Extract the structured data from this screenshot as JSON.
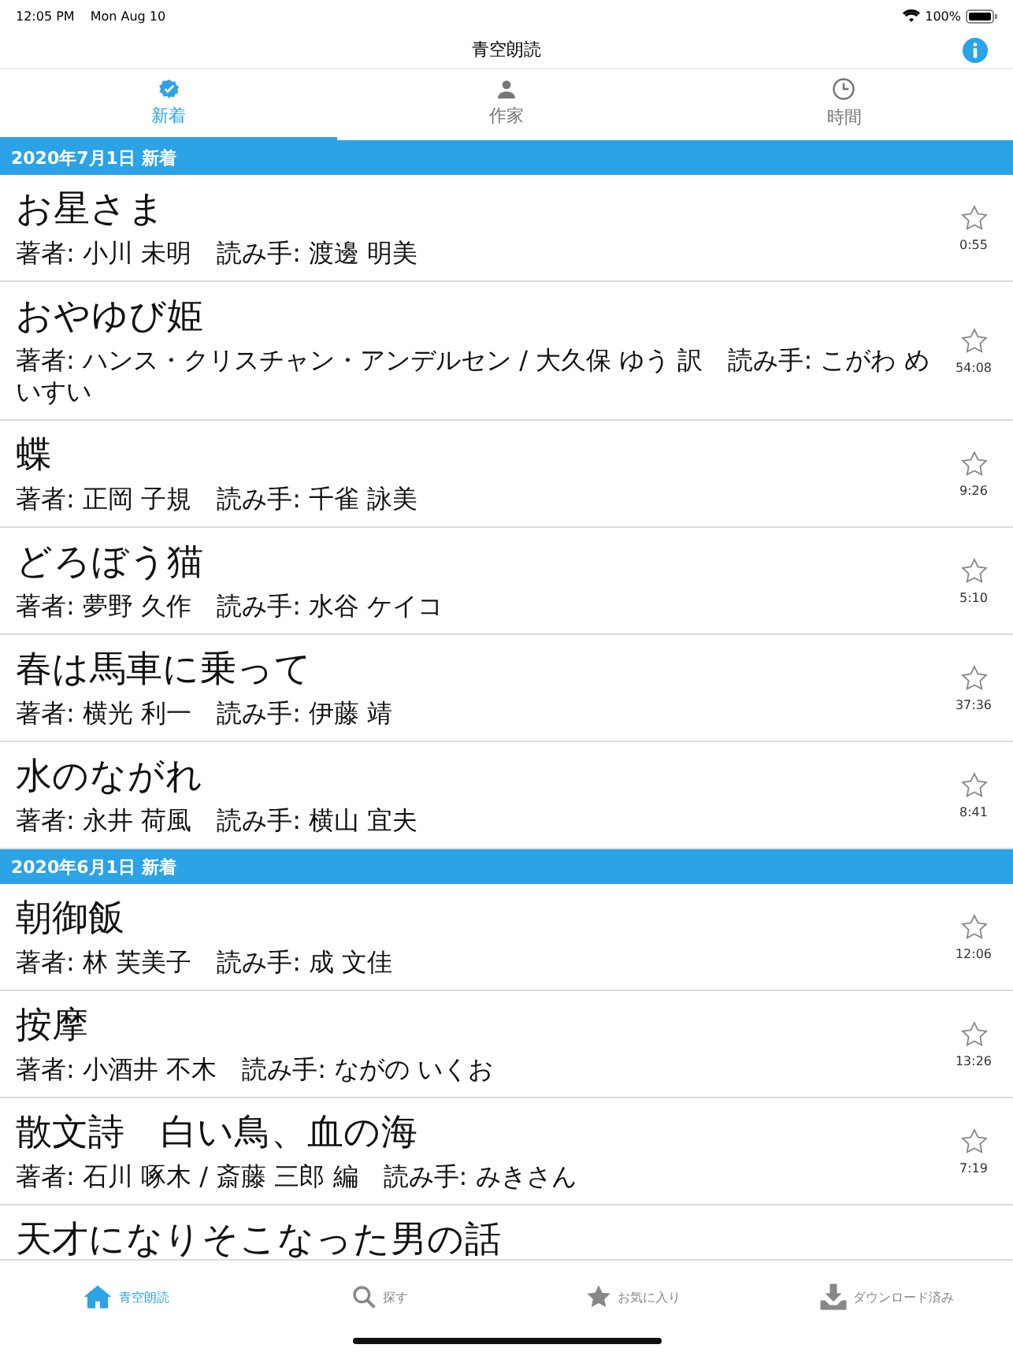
{
  "status_bar": {
    "time": "12:05 PM",
    "date": "Mon Aug 10",
    "battery": "100%"
  },
  "nav_bar": {
    "title": "青空朗読"
  },
  "tabs": [
    {
      "label": "新着",
      "kind": "badge",
      "selected": true
    },
    {
      "label": "作家",
      "kind": "person",
      "selected": false
    },
    {
      "label": "時間",
      "kind": "clock",
      "selected": false
    }
  ],
  "sections": [
    {
      "header": "2020年7月1日 新着",
      "rows": [
        {
          "title": "お星さま",
          "subtitle": "著者: 小川 未明　読み手: 渡邊 明美",
          "duration": "0:55"
        },
        {
          "title": "おやゆび姫",
          "subtitle": "著者: ハンス・クリスチャン・アンデルセン / 大久保 ゆう 訳　読み手: こがわ めいすい",
          "duration": "54:08"
        },
        {
          "title": "蝶",
          "subtitle": "著者: 正岡 子規　読み手: 千雀 詠美",
          "duration": "9:26"
        },
        {
          "title": "どろぼう猫",
          "subtitle": "著者: 夢野 久作　読み手: 水谷 ケイコ",
          "duration": "5:10"
        },
        {
          "title": "春は馬車に乗って",
          "subtitle": "著者: 横光 利一　読み手: 伊藤 靖",
          "duration": "37:36"
        },
        {
          "title": "水のながれ",
          "subtitle": "著者: 永井 荷風　読み手: 横山 宜夫",
          "duration": "8:41"
        }
      ]
    },
    {
      "header": "2020年6月1日 新着",
      "rows": [
        {
          "title": "朝御飯",
          "subtitle": "著者: 林 芙美子　読み手: 成 文佳",
          "duration": "12:06"
        },
        {
          "title": "按摩",
          "subtitle": "著者: 小酒井 不木　読み手: ながの いくお",
          "duration": "13:26"
        },
        {
          "title": "散文詩　白い鳥、血の海",
          "subtitle": "著者: 石川 啄木 / 斎藤 三郎 編　読み手: みきさん",
          "duration": "7:19"
        },
        {
          "title": "天才になりそこなった男の話"
        }
      ]
    }
  ],
  "tab_bar": [
    {
      "label": "青空朗読",
      "kind": "home",
      "selected": true
    },
    {
      "label": "探す",
      "kind": "search",
      "selected": false
    },
    {
      "label": "お気に入り",
      "kind": "star",
      "selected": false
    },
    {
      "label": "ダウンロード済み",
      "kind": "download",
      "selected": false
    }
  ]
}
